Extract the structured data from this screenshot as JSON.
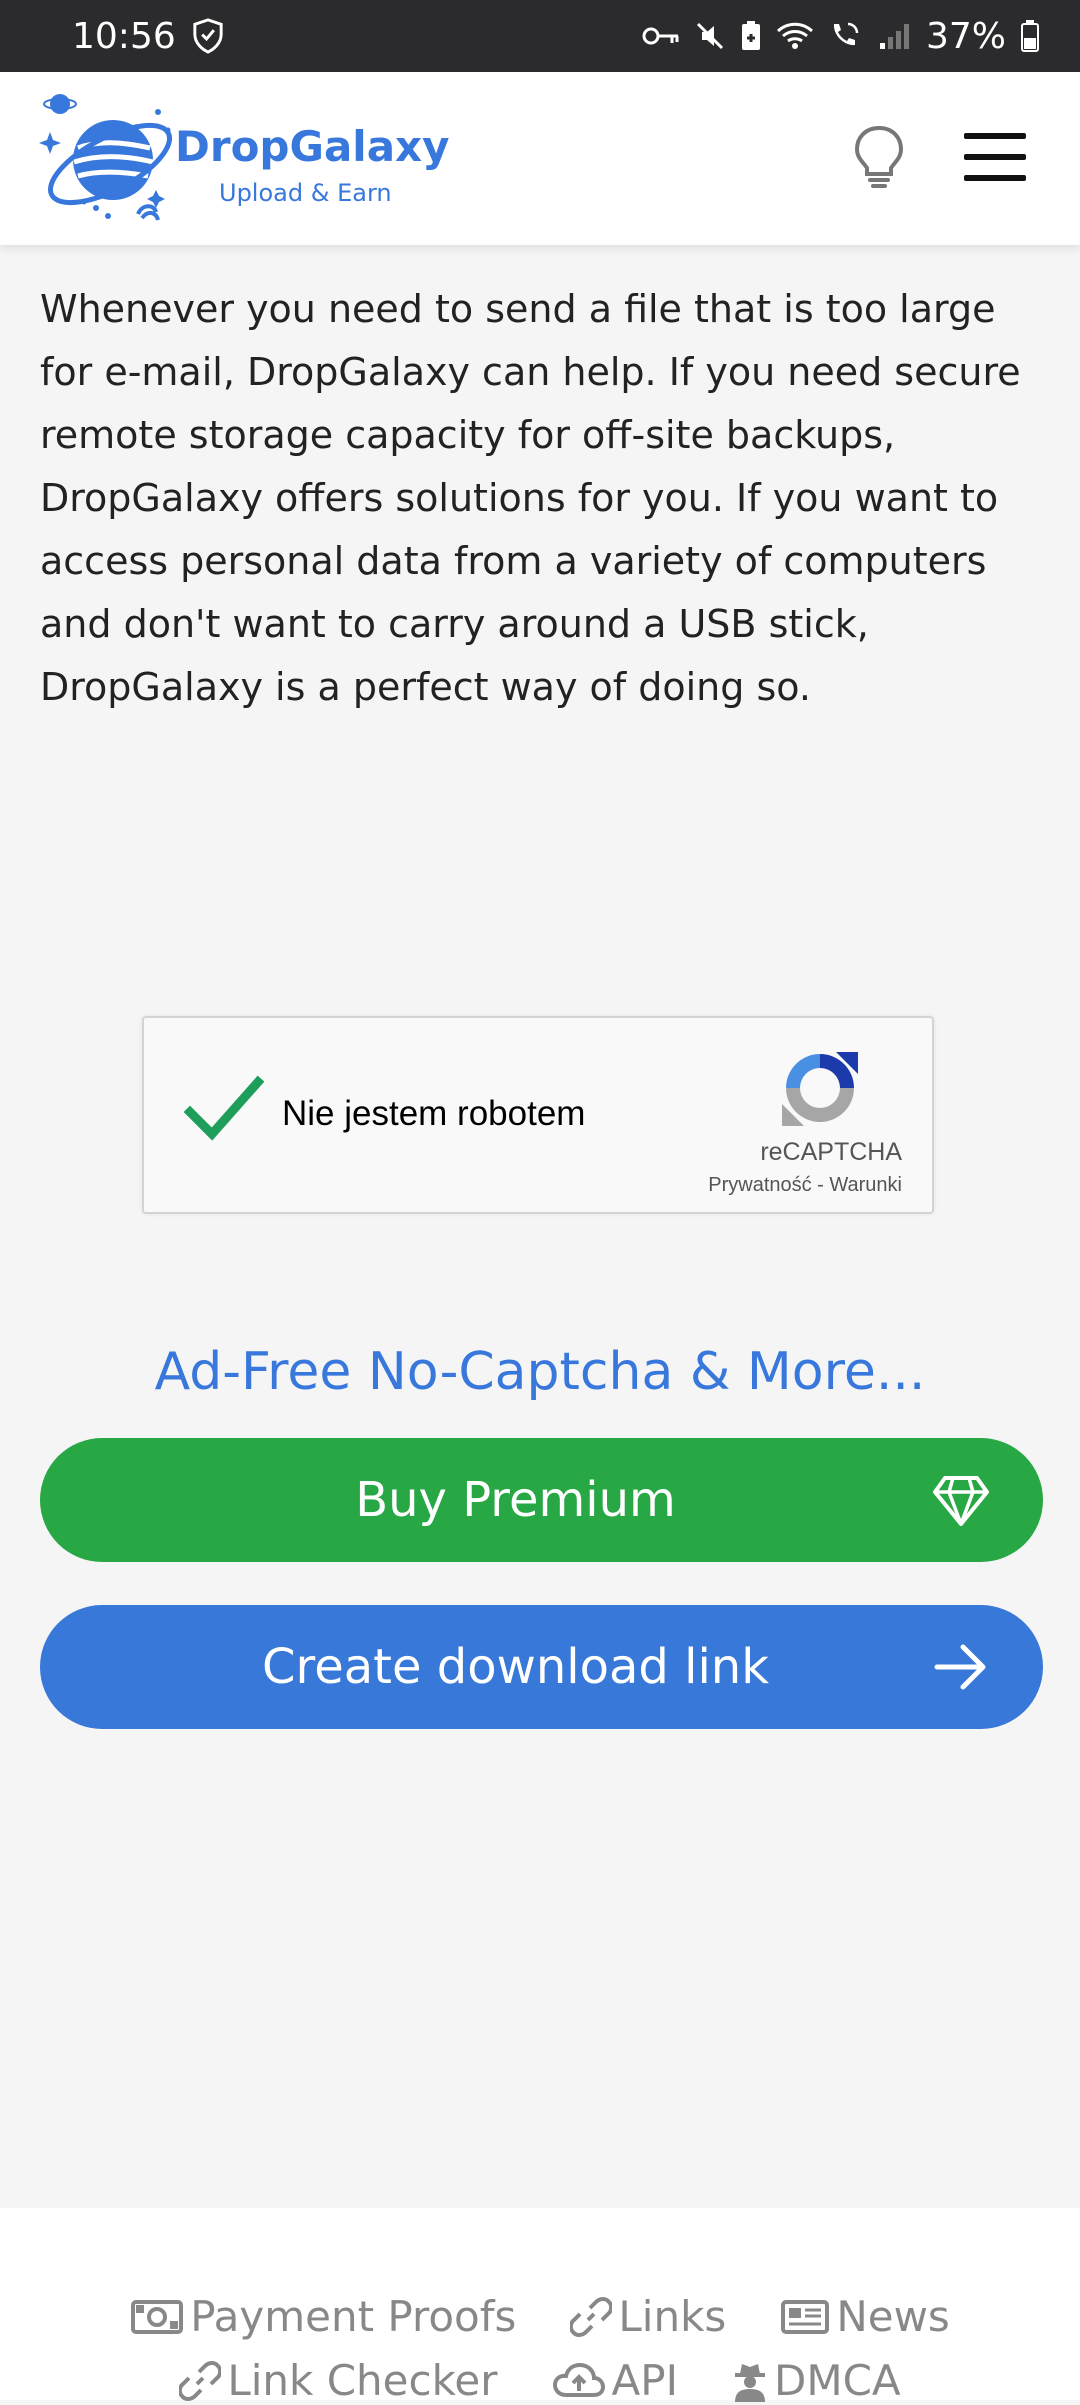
{
  "status_bar": {
    "time": "10:56",
    "battery": "37%"
  },
  "header": {
    "brand_name": "DropGalaxy",
    "brand_tagline": "Upload & Earn"
  },
  "main": {
    "intro_text": "Whenever you need to send a file that is too large for e-mail, DropGalaxy can help. If you need secure remote storage capacity for off-site backups, DropGalaxy offers solutions for you. If you want to access personal data from a variety of computers and don't want to carry around a USB stick, DropGalaxy is a perfect way of doing so."
  },
  "recaptcha": {
    "label": "Nie jestem robotem",
    "brand": "reCAPTCHA",
    "links": "Prywatność - Warunki",
    "checked": true
  },
  "promo": {
    "headline": "Ad-Free No-Captcha & More...",
    "buy_premium_label": "Buy Premium",
    "create_link_label": "Create download link"
  },
  "footer": {
    "row1": [
      {
        "label": "Payment Proofs",
        "icon": "money-icon"
      },
      {
        "label": "Links",
        "icon": "link-icon"
      },
      {
        "label": "News",
        "icon": "newspaper-icon"
      }
    ],
    "row2": [
      {
        "label": "Link Checker",
        "icon": "link-icon"
      },
      {
        "label": "API",
        "icon": "cloud-upload-icon"
      },
      {
        "label": "DMCA",
        "icon": "user-secret-icon"
      }
    ]
  },
  "colors": {
    "brand_blue": "#3877db",
    "premium_green": "#28a745",
    "download_blue": "#3878d8",
    "check_green": "#1e9e5a"
  }
}
